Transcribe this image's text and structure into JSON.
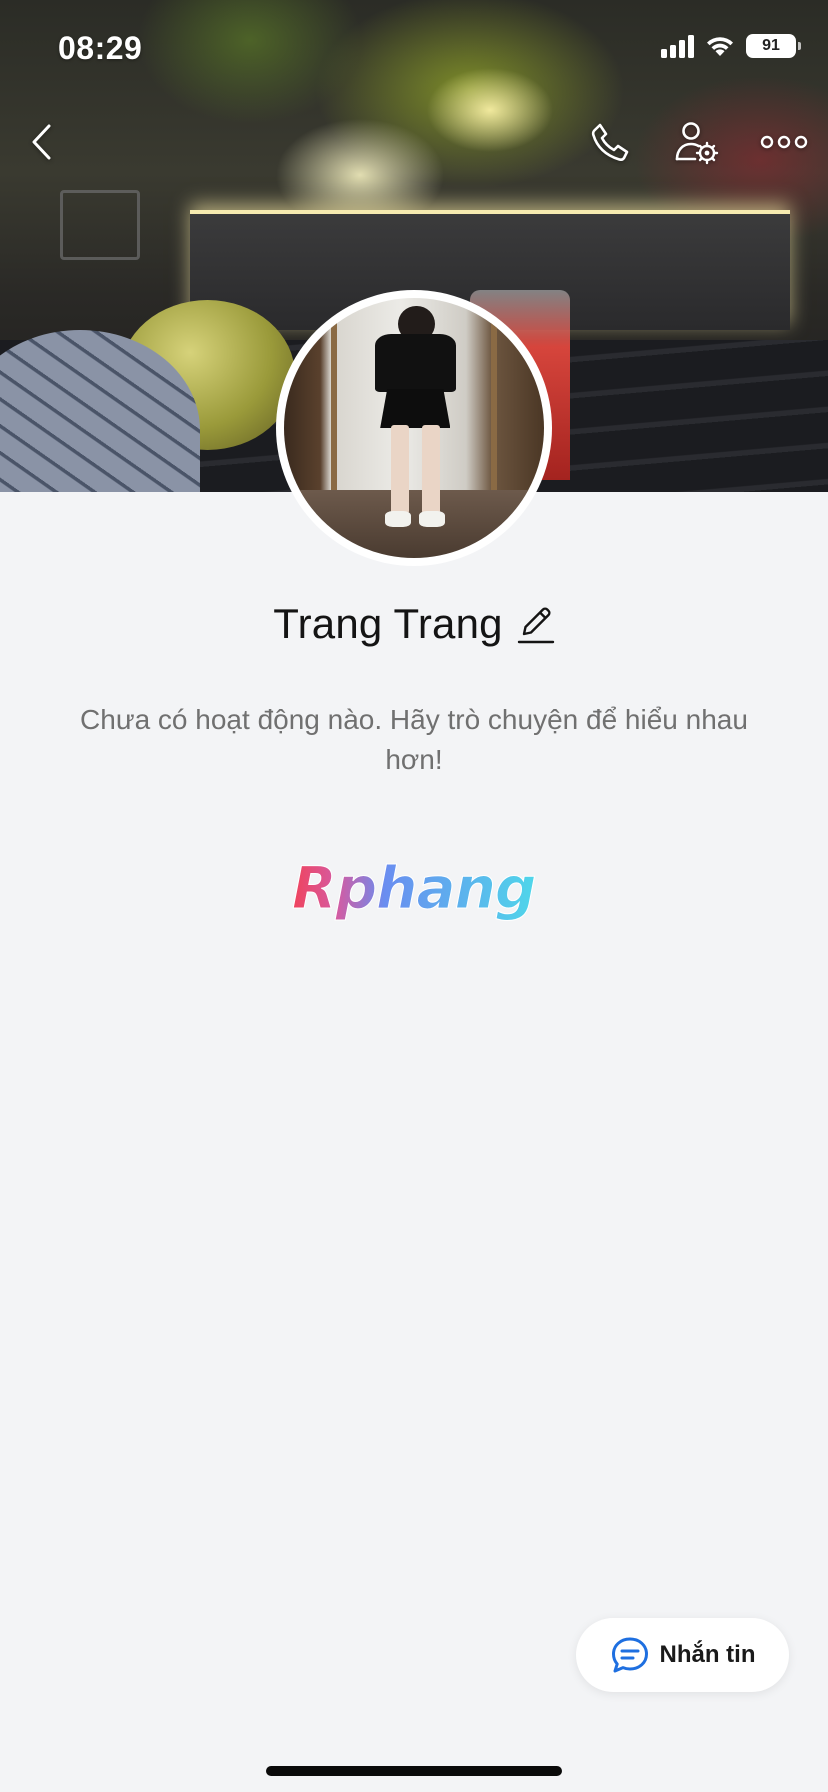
{
  "status_bar": {
    "time": "08:29",
    "battery_level": "91",
    "signal_icon": "cellular-signal-icon",
    "wifi_icon": "wifi-icon",
    "battery_icon": "battery-icon"
  },
  "header": {
    "back_icon": "chevron-left-icon",
    "call_icon": "phone-icon",
    "friend_settings_icon": "user-gear-icon",
    "more_icon": "more-dots-icon"
  },
  "profile": {
    "name": "Trang Trang",
    "edit_icon": "pencil-icon",
    "empty_message": "Chưa có hoạt động nào. Hãy trò chuyện để hiểu nhau hơn!"
  },
  "watermark": {
    "text": "Rphang"
  },
  "actions": {
    "message_label": "Nhắn tin",
    "message_icon": "chat-bubble-icon"
  },
  "colors": {
    "background": "#f3f4f6",
    "accent": "#1e6fe0",
    "text_primary": "#141414",
    "text_secondary": "#707070"
  }
}
